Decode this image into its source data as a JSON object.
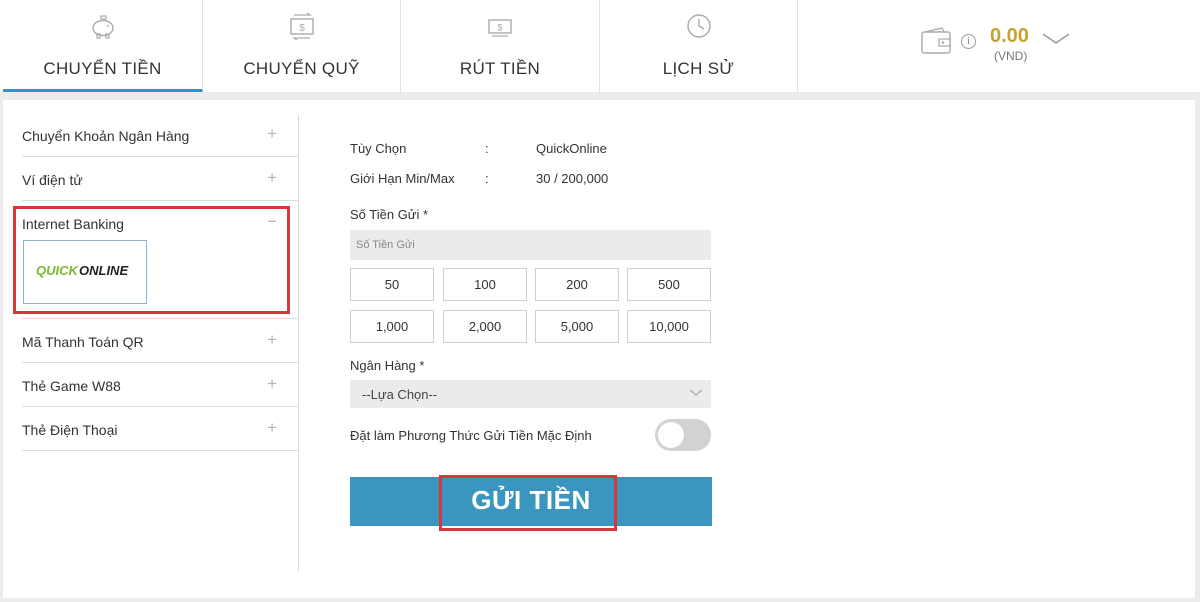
{
  "tabs": [
    {
      "label": "CHUYỂN TIỀN",
      "icon": "piggy-bank-icon"
    },
    {
      "label": "CHUYỂN QUỸ",
      "icon": "money-transfer-icon"
    },
    {
      "label": "RÚT TIỀN",
      "icon": "cash-withdraw-icon"
    },
    {
      "label": "LỊCH SỬ",
      "icon": "history-clock-icon"
    }
  ],
  "wallet": {
    "amount": "0.00",
    "currency": "(VND)",
    "info": "i"
  },
  "sidebar": {
    "items": [
      {
        "label": "Chuyển Khoản Ngân Hàng",
        "sign": "+"
      },
      {
        "label": "Ví điện tử",
        "sign": "+"
      },
      {
        "label": "Internet Banking",
        "sign": "−"
      },
      {
        "label": "Mã Thanh Toán QR",
        "sign": "+"
      },
      {
        "label": "Thẻ Game W88",
        "sign": "+"
      },
      {
        "label": "Thẻ Điện Thoại",
        "sign": "+"
      }
    ],
    "logo": {
      "part1": "QUICK",
      "part2": "ONLINE"
    }
  },
  "form": {
    "option_label": "Tùy Chọn",
    "option_sep": ":",
    "option_value": "QuickOnline",
    "limit_label": "Giới Hạn Min/Max",
    "limit_sep": ":",
    "limit_value": "30 / 200,000",
    "amount_label": "Số Tiền Gửi *",
    "amount_placeholder": "Số Tiền Gửi",
    "quick_amounts": [
      "50",
      "100",
      "200",
      "500",
      "1,000",
      "2,000",
      "5,000",
      "10,000"
    ],
    "bank_label": "Ngân Hàng *",
    "bank_select": "--Lựa Chọn--",
    "default_label": "Đặt làm Phương Thức Gửi Tiền Mặc Định",
    "default_on": false,
    "submit_label": "GỬI TIỀN"
  },
  "colors": {
    "accent": "#3a95bf",
    "highlight": "#d6373a",
    "balance": "#c9a232",
    "logo_green": "#79b82f"
  }
}
